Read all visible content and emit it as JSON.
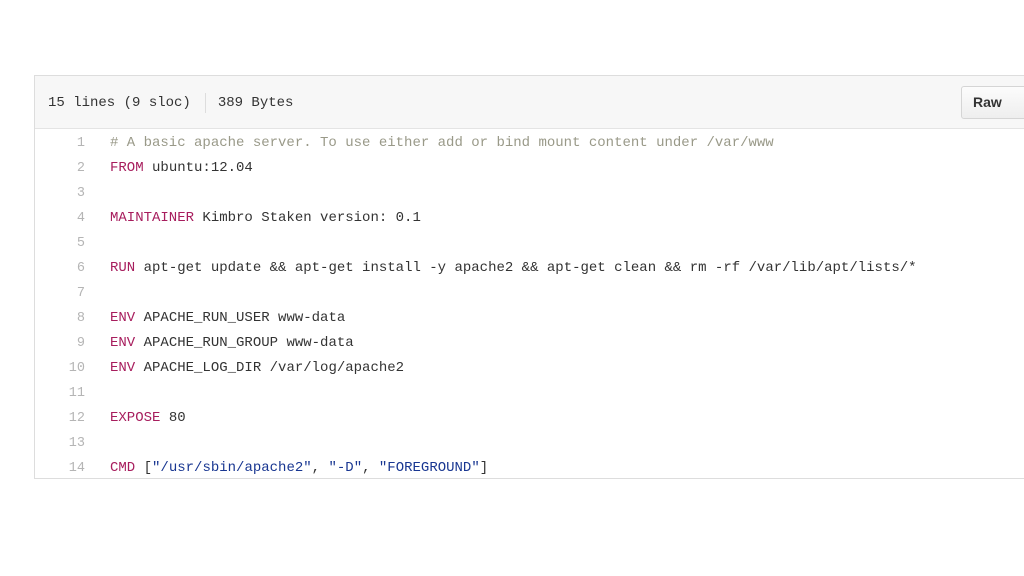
{
  "header": {
    "lines_info": "15 lines (9 sloc)",
    "size_info": "389 Bytes",
    "raw_label": "Raw"
  },
  "lines": [
    {
      "n": "1",
      "tokens": [
        {
          "t": "# A basic apache server. To use either add or bind mount content under /var/www",
          "c": "cm"
        }
      ]
    },
    {
      "n": "2",
      "tokens": [
        {
          "t": "FROM",
          "c": "kw"
        },
        {
          "t": " ubuntu:12.04",
          "c": ""
        }
      ]
    },
    {
      "n": "3",
      "tokens": []
    },
    {
      "n": "4",
      "tokens": [
        {
          "t": "MAINTAINER",
          "c": "kw"
        },
        {
          "t": " Kimbro Staken version: 0.1",
          "c": ""
        }
      ]
    },
    {
      "n": "5",
      "tokens": []
    },
    {
      "n": "6",
      "tokens": [
        {
          "t": "RUN",
          "c": "kw"
        },
        {
          "t": " apt-get update && apt-get install -y apache2 && apt-get clean && rm -rf /var/lib/apt/lists/*",
          "c": ""
        }
      ]
    },
    {
      "n": "7",
      "tokens": []
    },
    {
      "n": "8",
      "tokens": [
        {
          "t": "ENV",
          "c": "kw"
        },
        {
          "t": " APACHE_RUN_USER www-data",
          "c": ""
        }
      ]
    },
    {
      "n": "9",
      "tokens": [
        {
          "t": "ENV",
          "c": "kw"
        },
        {
          "t": " APACHE_RUN_GROUP www-data",
          "c": ""
        }
      ]
    },
    {
      "n": "10",
      "tokens": [
        {
          "t": "ENV",
          "c": "kw"
        },
        {
          "t": " APACHE_LOG_DIR /var/log/apache2",
          "c": ""
        }
      ]
    },
    {
      "n": "11",
      "tokens": []
    },
    {
      "n": "12",
      "tokens": [
        {
          "t": "EXPOSE",
          "c": "kw"
        },
        {
          "t": " 80",
          "c": ""
        }
      ]
    },
    {
      "n": "13",
      "tokens": []
    },
    {
      "n": "14",
      "tokens": [
        {
          "t": "CMD",
          "c": "kw"
        },
        {
          "t": " [",
          "c": ""
        },
        {
          "t": "\"/usr/sbin/apache2\"",
          "c": "str"
        },
        {
          "t": ", ",
          "c": ""
        },
        {
          "t": "\"-D\"",
          "c": "str"
        },
        {
          "t": ", ",
          "c": ""
        },
        {
          "t": "\"FOREGROUND\"",
          "c": "str"
        },
        {
          "t": "]",
          "c": ""
        }
      ]
    }
  ],
  "colors": {
    "keyword": "#a71d5d",
    "comment": "#999988",
    "string": "#183691",
    "line_number": "#b5b5b5"
  }
}
